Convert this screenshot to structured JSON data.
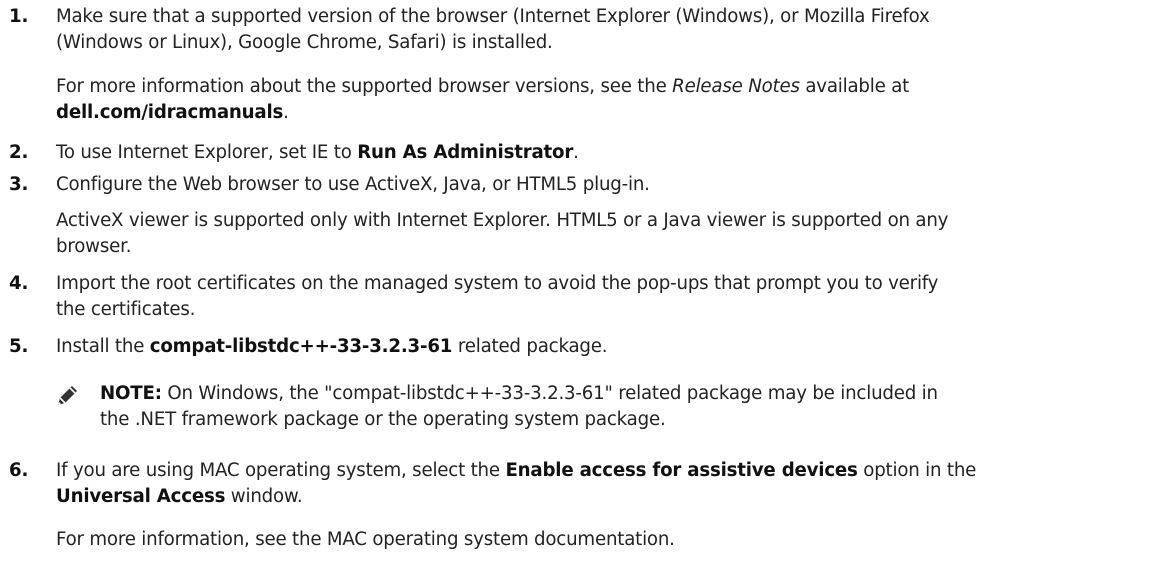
{
  "steps": [
    {
      "number": "1.",
      "line1": "Make sure that a supported version of the browser (Internet Explorer (Windows), or Mozilla Firefox",
      "line2": "(Windows or Linux), Google Chrome, Safari) is installed.",
      "para_pre": "For more information about the supported browser versions, see the ",
      "para_italic": "Release Notes",
      "para_post": " available at",
      "para_link": "dell.com/idracmanuals",
      "para_end": "."
    },
    {
      "number": "2.",
      "pre": "To use Internet Explorer, set IE to ",
      "bold": "Run As Administrator",
      "post": "."
    },
    {
      "number": "3.",
      "text": "Configure the Web browser to use ActiveX, Java, or HTML5 plug-in.",
      "para_line1": "ActiveX viewer is supported only with Internet Explorer. HTML5 or a Java viewer is supported on any",
      "para_line2": "browser."
    },
    {
      "number": "4.",
      "line1": "Import the root certificates on the managed system to avoid the pop-ups that prompt you to verify",
      "line2": "the certificates."
    },
    {
      "number": "5.",
      "pre": "Install the ",
      "bold": "compat-libstdc++-33-3.2.3-61",
      "post": " related package.",
      "note_label": "NOTE:",
      "note_line1": " On Windows, the \"compat-libstdc++-33-3.2.3-61\" related package may be included in",
      "note_line2": "the .NET framework package or the operating system package."
    },
    {
      "number": "6.",
      "pre": "If you are using MAC operating system, select the ",
      "bold1": "Enable access for assistive devices",
      "mid": " option in the",
      "bold2": "Universal Access",
      "post": " window.",
      "para": "For more information, see the MAC operating system documentation."
    }
  ],
  "colors": {
    "text": "#222222",
    "note_icon": "#333333"
  },
  "icons": {
    "note": "pencil-note-icon"
  }
}
